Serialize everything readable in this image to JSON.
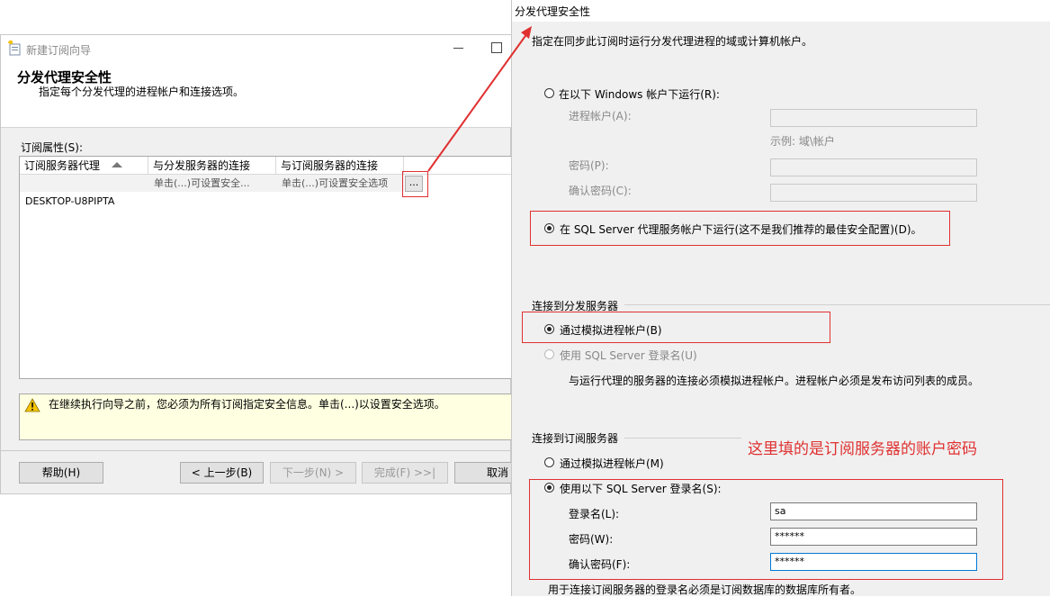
{
  "wizard": {
    "title": "新建订阅向导",
    "heading": "分发代理安全性",
    "subheading": "指定每个分发代理的进程帐户和连接选项。",
    "props_label": "订阅属性(S):",
    "columns": [
      "订阅服务器代理",
      "与分发服务器的连接",
      "与订阅服务器的连接"
    ],
    "rows": [
      {
        "agent": "DESKTOP-U8PIPTA",
        "dist_conn": "单击(...)可设置安全...",
        "sub_conn": "单击(...)可设置安全选项",
        "button": "..."
      }
    ],
    "warning": "在继续执行向导之前，您必须为所有订阅指定安全信息。单击(...)以设置安全选项。",
    "buttons": {
      "help": "帮助(H)",
      "back": "< 上一步(B)",
      "next": "下一步(N) >",
      "finish": "完成(F) >>|",
      "cancel": "取消"
    }
  },
  "dialog": {
    "title": "分发代理安全性",
    "description": "指定在同步此订阅时运行分发代理进程的域或计算机帐户。",
    "run_under_windows": "在以下 Windows 帐户下运行(R):",
    "process_account_label": "进程帐户(A):",
    "example_text": "示例: 域\\帐户",
    "password_label": "密码(P):",
    "confirm_password_label": "确认密码(C):",
    "run_under_sql_agent": "在 SQL Server 代理服务帐户下运行(这不是我们推荐的最佳安全配置)(D)。",
    "distributor_section": "连接到分发服务器",
    "dist_impersonate": "通过模拟进程帐户(B)",
    "dist_sql_login": "使用 SQL Server 登录名(U)",
    "dist_note": "与运行代理的服务器的连接必须模拟进程帐户。进程帐户必须是发布访问列表的成员。",
    "subscriber_section": "连接到订阅服务器",
    "sub_impersonate": "通过模拟进程帐户(M)",
    "sub_sql_login": "使用以下 SQL Server 登录名(S):",
    "login_label": "登录名(L):",
    "login_value": "sa",
    "sub_password_label": "密码(W):",
    "sub_password_value": "******",
    "sub_confirm_label": "确认密码(F):",
    "sub_confirm_value": "******",
    "bottom_note": "用于连接订阅服务器的登录名必须是订阅数据库的数据库所有者。"
  },
  "annotation": "这里填的是订阅服务器的账户密码",
  "colors": {
    "highlight_red": "#e03030",
    "warning_bg": "#ffffe1",
    "focus_blue": "#0078d7"
  }
}
